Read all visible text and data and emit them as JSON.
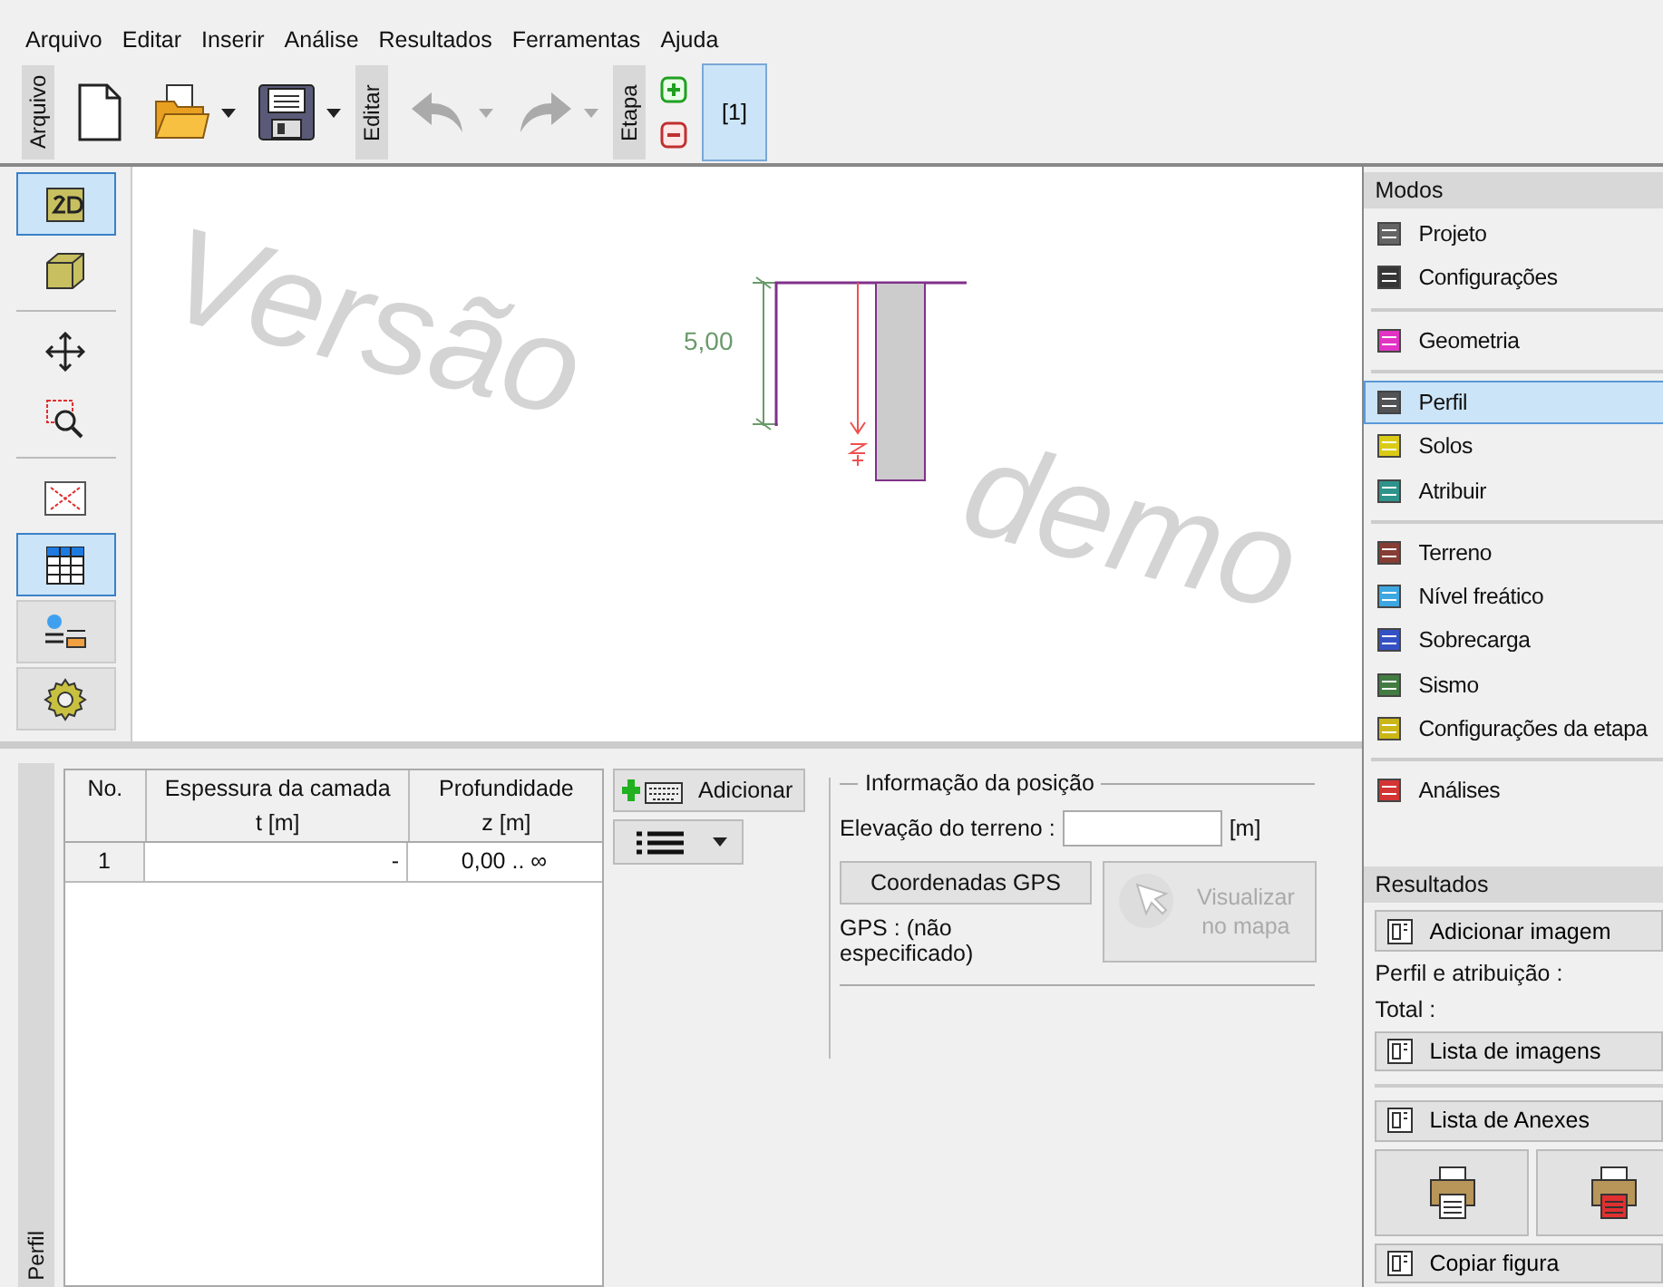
{
  "menu": [
    "Arquivo",
    "Editar",
    "Inserir",
    "Análise",
    "Resultados",
    "Ferramentas",
    "Ajuda"
  ],
  "toolbar": {
    "groups": [
      "Arquivo",
      "Editar",
      "Etapa"
    ],
    "stage": {
      "label": "[1]",
      "selected": true
    }
  },
  "view_tools": [
    {
      "selected": true
    },
    {
      "selected": false
    },
    {
      "selected": false
    },
    {
      "selected": false
    },
    {
      "selected": false
    },
    {
      "selected": true
    },
    {
      "selected": false
    },
    {
      "selected": false
    }
  ],
  "canvas": {
    "watermark": [
      "Versão",
      "demo"
    ],
    "dimension": "5,00"
  },
  "side_tab": "Perfil",
  "table": {
    "columns": [
      {
        "title": "No."
      },
      {
        "title": "Espessura da camada",
        "unit": "t [m]"
      },
      {
        "title": "Profundidade",
        "unit": "z [m]"
      }
    ],
    "rows": [
      {
        "no": "1",
        "thickness": "-",
        "depth": "0,00 .. ∞"
      }
    ]
  },
  "add_button": "Adicionar",
  "position": {
    "title": "Informação da posição",
    "elevation_label": "Elevação do terreno :",
    "unit": "[m]",
    "gps_button": "Coordenadas GPS",
    "map_button": "Visualizar no mapa",
    "map_disabled": true,
    "gps_status": "GPS : (não especificado)"
  },
  "modes": {
    "title": "Modos",
    "groups": [
      [
        {
          "label": "Projeto",
          "selected": false
        },
        {
          "label": "Configurações",
          "selected": false
        }
      ],
      [
        {
          "label": "Geometria",
          "selected": false
        }
      ],
      [
        {
          "label": "Perfil",
          "selected": true
        },
        {
          "label": "Solos",
          "selected": false
        },
        {
          "label": "Atribuir",
          "selected": false
        }
      ],
      [
        {
          "label": "Terreno",
          "selected": false
        },
        {
          "label": "Nível freático",
          "selected": false
        },
        {
          "label": "Sobrecarga",
          "selected": false
        },
        {
          "label": "Sismo",
          "selected": false
        },
        {
          "label": "Configurações da etapa",
          "selected": false
        }
      ],
      [
        {
          "label": "Análises",
          "selected": false
        }
      ]
    ]
  },
  "results": {
    "title": "Resultados",
    "items": [
      {
        "kind": "button",
        "label": "Adicionar imagem"
      },
      {
        "kind": "text",
        "label": "Perfil e atribuição :"
      },
      {
        "kind": "text",
        "label": "Total :"
      },
      {
        "kind": "button",
        "label": "Lista de imagens"
      },
      {
        "kind": "divider"
      },
      {
        "kind": "button",
        "label": "Lista de Anexes"
      },
      {
        "kind": "print"
      },
      {
        "kind": "button",
        "label": "Copiar figura"
      }
    ]
  }
}
